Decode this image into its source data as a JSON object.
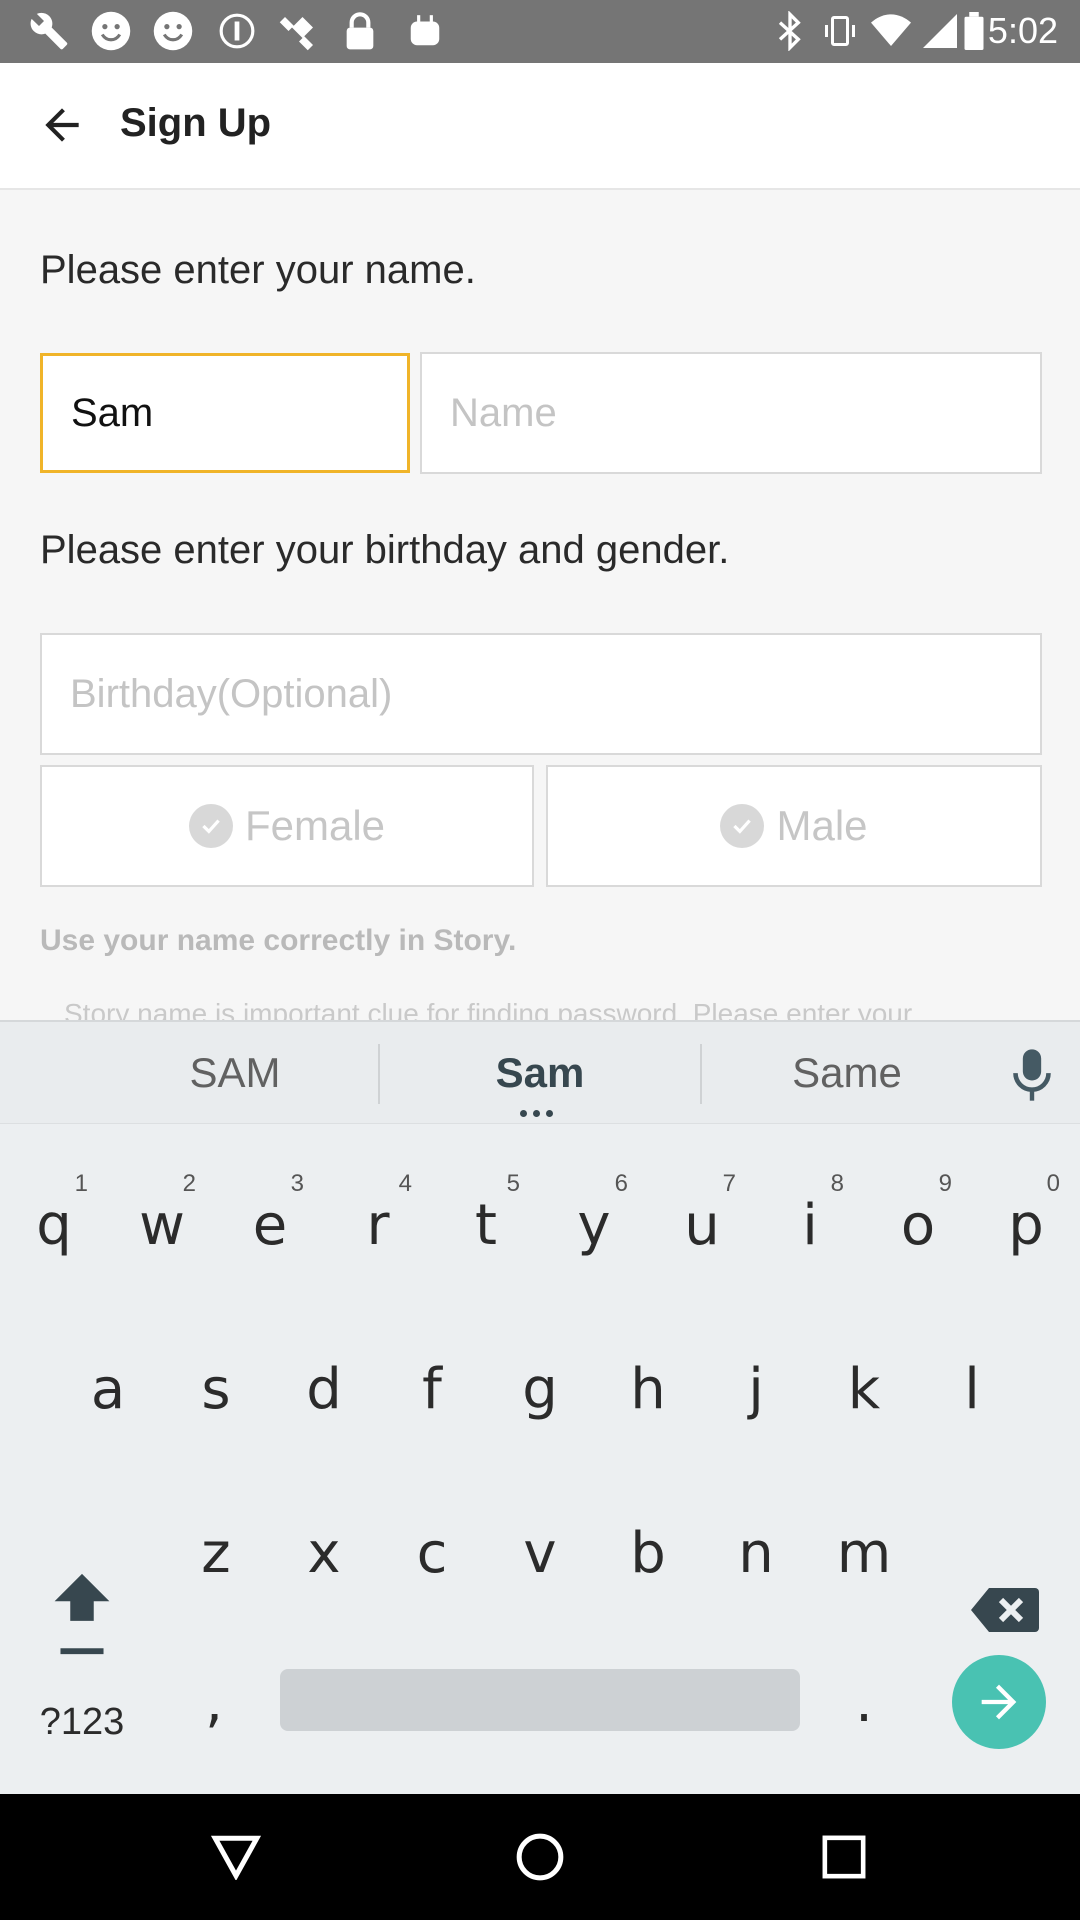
{
  "status_bar": {
    "time": "5:02",
    "icons": [
      "wrench-icon",
      "smiley-icon",
      "smiley-icon",
      "info-icon",
      "satellite-icon",
      "lock-icon",
      "android-icon",
      "bluetooth-icon",
      "vibrate-icon",
      "wifi-icon",
      "signal-icon",
      "battery-icon"
    ]
  },
  "app_bar": {
    "title": "Sign Up",
    "back_icon": "arrow-back-icon"
  },
  "form": {
    "name_prompt": "Please enter your name.",
    "first_name_value": "Sam",
    "last_name_placeholder": "Name",
    "birthday_prompt": "Please enter your birthday and gender.",
    "birthday_placeholder": "Birthday(Optional)",
    "female_label": "Female",
    "male_label": "Male",
    "hint": "Use your name correctly in Story.",
    "hint_more": "Story name is important clue for finding password. Please enter your"
  },
  "keyboard": {
    "suggestions": [
      "SAM",
      "Sam",
      "Same"
    ],
    "row1": [
      {
        "k": "q",
        "n": "1"
      },
      {
        "k": "w",
        "n": "2"
      },
      {
        "k": "e",
        "n": "3"
      },
      {
        "k": "r",
        "n": "4"
      },
      {
        "k": "t",
        "n": "5"
      },
      {
        "k": "y",
        "n": "6"
      },
      {
        "k": "u",
        "n": "7"
      },
      {
        "k": "i",
        "n": "8"
      },
      {
        "k": "o",
        "n": "9"
      },
      {
        "k": "p",
        "n": "0"
      }
    ],
    "row2": [
      "a",
      "s",
      "d",
      "f",
      "g",
      "h",
      "j",
      "k",
      "l"
    ],
    "row3": [
      "z",
      "x",
      "c",
      "v",
      "b",
      "n",
      "m"
    ],
    "symbols_key": "?123",
    "comma_key": ",",
    "period_key": ".",
    "accent_color": "#49c2b2"
  },
  "colors": {
    "focus_border": "#f0b429",
    "status_bar": "#757575"
  }
}
